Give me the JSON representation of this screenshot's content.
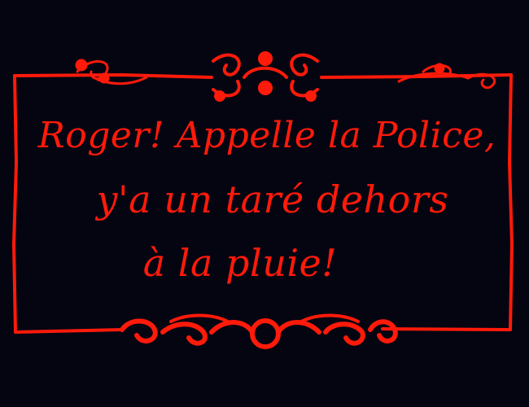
{
  "card": {
    "lines": [
      "Roger! Appelle la Police,",
      "y'a un taré dehors",
      "à la pluie!"
    ]
  },
  "colors": {
    "background": "#050511",
    "ink": "#ff1a0a"
  }
}
